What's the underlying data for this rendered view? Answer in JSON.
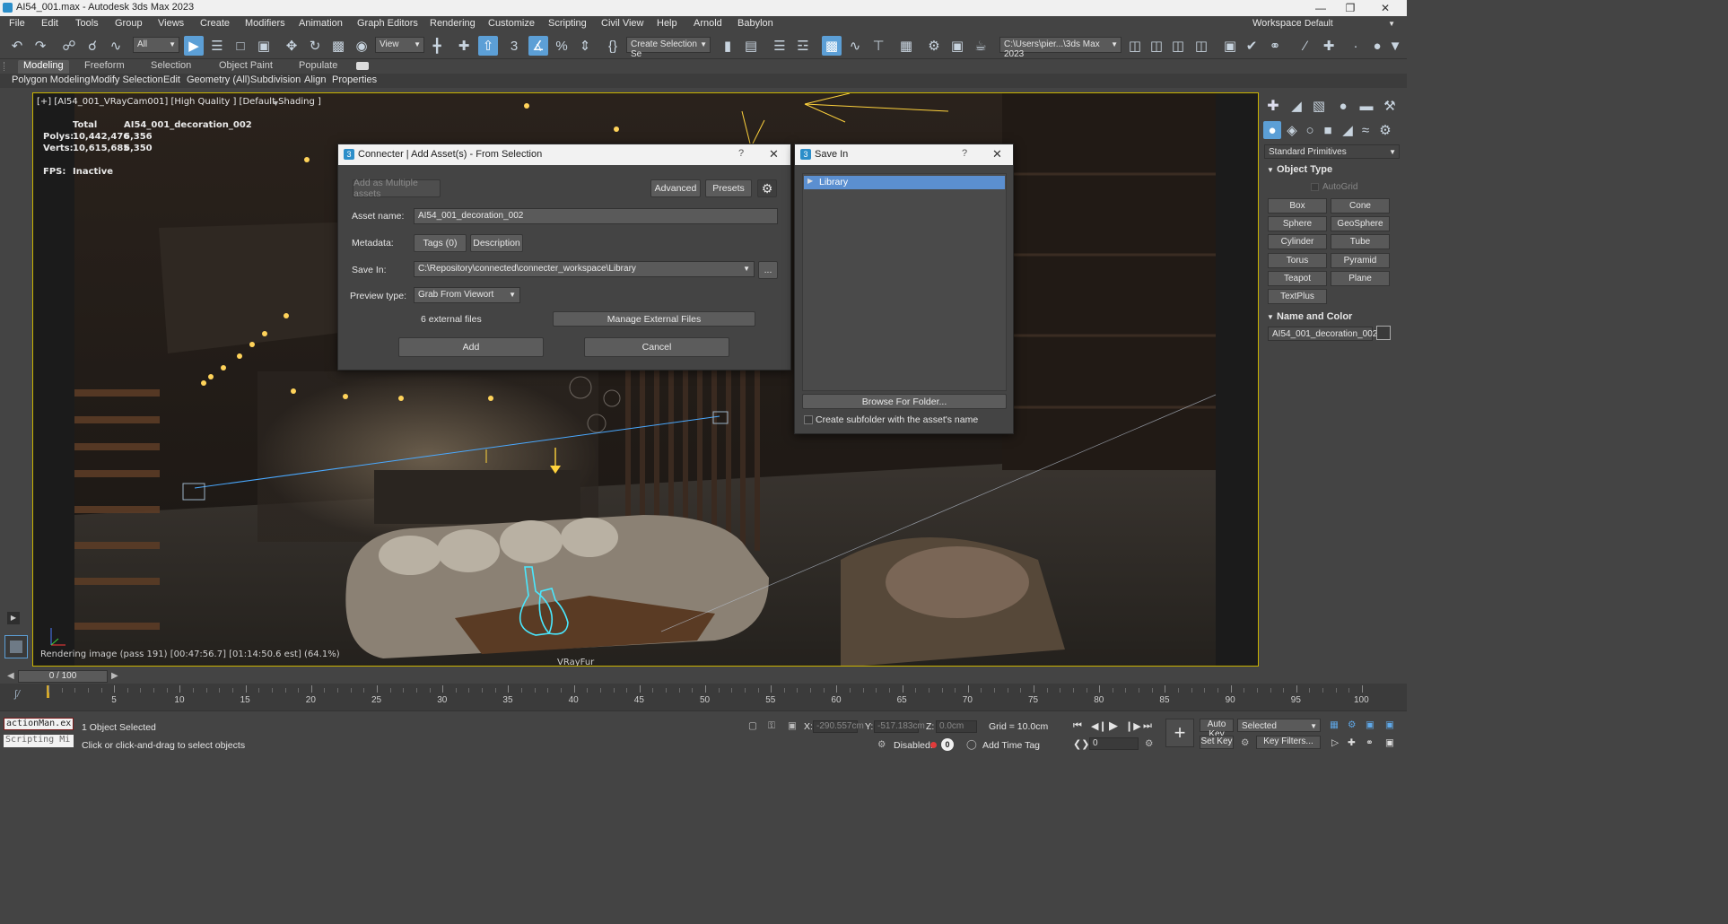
{
  "window": {
    "title": "AI54_001.max - Autodesk 3ds Max 2023",
    "workspaces_label": "Workspaces:",
    "workspace_value": "Default"
  },
  "menu": [
    "File",
    "Edit",
    "Tools",
    "Group",
    "Views",
    "Create",
    "Modifiers",
    "Animation",
    "Graph Editors",
    "Rendering",
    "Customize",
    "Scripting",
    "Civil View",
    "Help",
    "Arnold",
    "Babylon"
  ],
  "toolbar": {
    "selection_filter": "All",
    "ref_coord": "View",
    "named_selection": "Create Selection Se",
    "project_path": "C:\\Users\\pier...\\3ds Max 2023"
  },
  "ribbon": {
    "tabs": [
      "Modeling",
      "Freeform",
      "Selection",
      "Object Paint",
      "Populate"
    ],
    "items": [
      "Polygon Modeling",
      "Modify Selection",
      "Edit",
      "Geometry (All)",
      "Subdivision",
      "Align",
      "Properties"
    ]
  },
  "viewport": {
    "label": "[+] [AI54_001_VRayCam001] [High Quality ] [Default Shading ]",
    "stats_total_label": "Total",
    "stats_object": "AI54_001_decoration_002",
    "polys_label": "Polys:",
    "polys_total": "10,442,476",
    "polys_sel": "6,356",
    "verts_label": "Verts:",
    "verts_total": "10,615,685",
    "verts_sel": "6,350",
    "fps_label": "FPS:",
    "fps_value": "Inactive",
    "render_status": "Rendering image (pass 191) [00:47:56.7] [01:14:50.6 est]    (64.1%)",
    "render_progress": 0.641,
    "bottom_label": "VRayFur"
  },
  "connecter_dialog": {
    "title": "Connecter | Add Asset(s) - From Selection",
    "add_multiple": "Add as Multiple assets",
    "advanced": "Advanced",
    "presets": "Presets",
    "asset_name_label": "Asset name:",
    "asset_name_value": "AI54_001_decoration_002",
    "metadata_label": "Metadata:",
    "tags_button": "Tags (0)",
    "description_button": "Description",
    "save_in_label": "Save In:",
    "save_in_value": "C:\\Repository\\connected\\connecter_workspace\\Library",
    "browse_button": "...",
    "preview_type_label": "Preview type:",
    "preview_type_value": "Grab From Viewort",
    "external_files": "6 external files",
    "manage_external": "Manage External Files",
    "add_button": "Add",
    "cancel_button": "Cancel"
  },
  "save_in_dialog": {
    "title": "Save In",
    "tree_item": "Library",
    "browse_folder": "Browse For Folder...",
    "subfolder_checkbox": "Create subfolder with the asset's name",
    "subfolder_checked": false
  },
  "command_panel": {
    "category": "Standard Primitives",
    "object_type_header": "Object Type",
    "autogrid": "AutoGrid",
    "primitives": [
      "Box",
      "Cone",
      "Sphere",
      "GeoSphere",
      "Cylinder",
      "Tube",
      "Torus",
      "Pyramid",
      "Teapot",
      "Plane",
      "TextPlus"
    ],
    "name_color_header": "Name and Color",
    "object_name": "AI54_001_decoration_002",
    "object_color": "#3a3a3a"
  },
  "timeline": {
    "frame_display": "0 / 100",
    "ticks": [
      "0",
      "5",
      "10",
      "15",
      "20",
      "25",
      "30",
      "35",
      "40",
      "45",
      "50",
      "55",
      "60",
      "65",
      "70",
      "75",
      "80",
      "85",
      "90",
      "95",
      "100"
    ]
  },
  "status": {
    "script_listener_1": "actionMan.ex",
    "script_listener_2": "Scripting Mi",
    "selection_count": "1 Object Selected",
    "prompt": "Click or click-and-drag to select objects",
    "x_label": "X:",
    "x_value": "-290.557cm",
    "y_label": "Y:",
    "y_value": "-517.183cm",
    "z_label": "Z:",
    "z_value": "0.0cm",
    "grid": "Grid = 10.0cm",
    "disabled_label": "Disabled:",
    "disabled_count": "0",
    "add_time_tag": "Add Time Tag",
    "auto_key": "Auto Key",
    "set_key": "Set Key",
    "key_mode": "Selected",
    "key_filters": "Key Filters...",
    "frame_spinner": "0"
  }
}
